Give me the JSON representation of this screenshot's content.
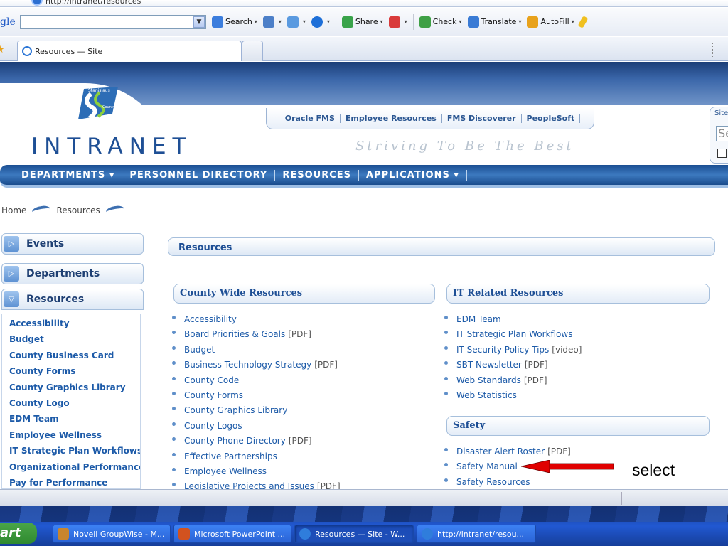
{
  "browser": {
    "address_url": "http://intranet/resources",
    "google_label": "gle",
    "toolbar": [
      {
        "label": "Search",
        "color": "#3b7ddd"
      },
      {
        "label": "",
        "color": "#4c7fc8"
      },
      {
        "label": "",
        "color": "#5a9ae0"
      },
      {
        "label": "",
        "color": "#1d6fd8"
      },
      {
        "label": "Share",
        "color": "#39a34a"
      },
      {
        "label": "",
        "color": "#d93b3b"
      },
      {
        "label": "Check",
        "color": "#3fa046"
      },
      {
        "label": "Translate",
        "color": "#3a7bd5"
      },
      {
        "label": "AutoFill",
        "color": "#e8a21c"
      }
    ],
    "tab_title": "Resources — Site"
  },
  "header": {
    "logo_text_top": "Stanislaus",
    "logo_text_bottom": "County",
    "brand": "INTRANET",
    "slogan": "Striving To Be The Best",
    "top_links": [
      "Oracle FMS",
      "Employee Resources",
      "FMS Discoverer",
      "PeopleSoft"
    ],
    "site_search_label": "Site",
    "site_search_value": "Se"
  },
  "nav": {
    "departments": "DEPARTMENTS ▾",
    "personnel": "PERSONNEL DIRECTORY",
    "resources": "RESOURCES",
    "applications": "APPLICATIONS ▾"
  },
  "breadcrumb": {
    "home": "Home",
    "current": "Resources"
  },
  "sidebar": {
    "events": "Events",
    "departments": "Departments",
    "resources": "Resources",
    "items": [
      "Accessibility",
      "Budget",
      "County Business Card",
      "County Forms",
      "County Graphics Library",
      "County Logo",
      "EDM Team",
      "Employee Wellness",
      "IT Strategic Plan Workflows",
      "Organizational Performance",
      "Pay for Performance"
    ]
  },
  "content": {
    "heading": "Resources",
    "county_title": "County Wide Resources",
    "county_items": [
      {
        "text": "Accessibility",
        "note": ""
      },
      {
        "text": "Board Priorities & Goals",
        "note": "[PDF]"
      },
      {
        "text": "Budget",
        "note": ""
      },
      {
        "text": "Business Technology Strategy",
        "note": "[PDF]"
      },
      {
        "text": "County Code",
        "note": ""
      },
      {
        "text": "County Forms",
        "note": ""
      },
      {
        "text": "County Graphics Library",
        "note": ""
      },
      {
        "text": "County Logos",
        "note": ""
      },
      {
        "text": "County Phone Directory",
        "note": "[PDF]"
      },
      {
        "text": "Effective Partnerships",
        "note": ""
      },
      {
        "text": "Employee Wellness",
        "note": ""
      },
      {
        "text": "Legislative Projects and Issues",
        "note": "[PDF]"
      }
    ],
    "it_title": "IT Related Resources",
    "it_items": [
      {
        "text": "EDM Team",
        "note": ""
      },
      {
        "text": "IT Strategic Plan Workflows",
        "note": ""
      },
      {
        "text": "IT Security Policy Tips",
        "note": "[video]"
      },
      {
        "text": "SBT Newsletter",
        "note": "[PDF]"
      },
      {
        "text": "Web Standards",
        "note": "[PDF]"
      },
      {
        "text": "Web Statistics",
        "note": ""
      }
    ],
    "safety_title": "Safety",
    "safety_items": [
      {
        "text": "Disaster Alert Roster",
        "note": "[PDF]"
      },
      {
        "text": "Safety Manual",
        "note": ""
      },
      {
        "text": "Safety Resources",
        "note": ""
      }
    ]
  },
  "annotation": {
    "label": "select",
    "arrow_color": "#e00000"
  },
  "taskbar": {
    "start": "art",
    "tasks": [
      {
        "label": "Novell GroupWise - M...",
        "color": "#c9852d"
      },
      {
        "label": "Microsoft PowerPoint ...",
        "color": "#d2521f"
      },
      {
        "label": "Resources — Site - W...",
        "color": "#2f7ddc"
      },
      {
        "label": "http://intranet/resou...",
        "color": "#2f7ddc"
      }
    ]
  }
}
